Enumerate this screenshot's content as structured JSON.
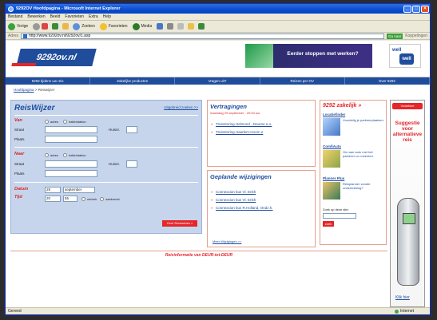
{
  "window": {
    "title": "9292OV Hoofdpagina - Microsoft Internet Explorer"
  },
  "menu": [
    "Bestand",
    "Bewerken",
    "Beeld",
    "Favorieten",
    "Extra",
    "Help"
  ],
  "toolbar": {
    "back": "Vorige",
    "search": "Zoeken",
    "favorites": "Favorieten",
    "media": "Media"
  },
  "address": {
    "label": "Adres",
    "url": "http://www.9292ov.nl/9292ov/1.asp",
    "go": "Ga naar",
    "links": "Koppelingen"
  },
  "site": {
    "logo": "9292ov.nl",
    "promo": "Eerder stoppen met werken?",
    "well1": "well",
    "well2": "well"
  },
  "nav": [
    "9292 tijdens uw reis",
    "Zakelijke producten",
    "Vragen uit?",
    "Reizen per OV",
    "Over 9292"
  ],
  "crumbs": {
    "home": "Hoofdpagina",
    "sep": ">",
    "current": "Reiswijzer"
  },
  "reiswijzer": {
    "title": "ReisWijzer",
    "link": "Uitgebreid zoeken >>",
    "van": "Van",
    "naar": "Naar",
    "adres": "adres",
    "halte": "halte/station",
    "straat": "Straat",
    "plaats": "Plaats",
    "huisnr": "Huisnr.",
    "datum": "Datum",
    "tijd": "Tijd",
    "day": "29",
    "month": "september",
    "hour": "20",
    "minute": "55",
    "vertrek": "vertrek",
    "aankomst": "aankomst",
    "submit": "Geef Reisadvies »"
  },
  "vertragingen": {
    "title": "Vertragingen",
    "date": "maandag 29 september - 20:54 uur",
    "items": [
      "Treinstoring Helmond - Deurne e.o.",
      "Treinstoring Haarlem-Hoorn e"
    ]
  },
  "gepland": {
    "title": "Geplande wijzigingen",
    "items": [
      "Connexxion bus Vl. Enkh",
      "Connexxion bus Vl. Enkh",
      "Connexxion bus R.Holland, Ondz.h."
    ],
    "more": "Meer Wijzigingen >>"
  },
  "zakelijk": {
    "title": "9292 zakelijk »",
    "items": [
      {
        "title": "Locatiefinder",
        "desc": "Voordelig je parkeerplaatsen."
      },
      {
        "title": "ComfiAuto",
        "desc": "Om aan auto met het parkeren ov meenten."
      },
      {
        "title": "Planner Plus",
        "desc": "Reisplanner zonder onderbreking?"
      }
    ],
    "search_label": "Zoek op deze site:",
    "search_btn": "zoek"
  },
  "footer": "Reisinformatie van DEUR-tot-DEUR",
  "ad": {
    "brand": "Vodafone",
    "text": "Suggestie voor alternatieve reis",
    "cta": "Klik hier"
  },
  "status": {
    "left": "Gereed",
    "zone": "Internet"
  }
}
